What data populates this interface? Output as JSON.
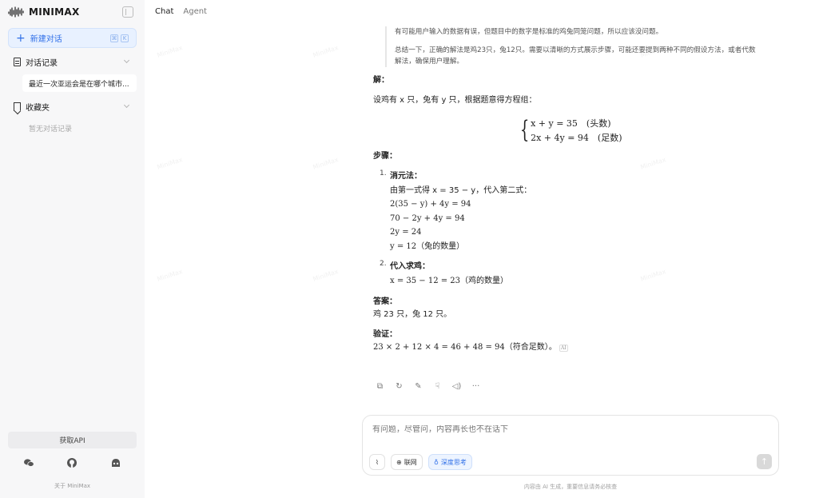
{
  "app": {
    "brand": "MINIMAX"
  },
  "sidebar": {
    "new_chat": "新建对话",
    "history_label": "对话记录",
    "history_items": [
      "最近一次亚运会是在哪个城市..."
    ],
    "favorites_label": "收藏夹",
    "favorites_empty": "暂无对话记录",
    "api_button": "获取API",
    "about": "关于 MiniMax"
  },
  "header": {
    "tabs": [
      "Chat",
      "Agent"
    ]
  },
  "thought": [
    "有可能用户输入的数据有误，但题目中的数字是标准的鸡兔同笼问题，所以应该没问题。",
    "总结一下，正确的解法是鸡23只，兔12只。需要以清晰的方式展示步骤，可能还要提到两种不同的假设方法，或者代数解法，确保用户理解。"
  ],
  "answer": {
    "solution_heading": "解：",
    "setup": "设鸡有 x 只，兔有 y 只，根据题意得方程组：",
    "eq1": "x + y = 35　(头数)",
    "eq2": "2x + 4y = 94　(足数)",
    "steps_heading": "步骤：",
    "step1_title": "消元法：",
    "step1_lines": [
      "由第一式得 x = 35 − y，代入第二式：",
      "2(35 − y) + 4y = 94",
      "70 − 2y + 4y = 94",
      "2y = 24",
      "y = 12（兔的数量）"
    ],
    "step2_title": "代入求鸡：",
    "step2_line": "x = 35 − 12 = 23（鸡的数量）",
    "answer_heading": "答案：",
    "answer_text": "鸡 23 只，兔 12 只。",
    "verify_heading": "验证：",
    "verify_text": "23 × 2 + 12 × 4 = 46 + 48 = 94（符合足数）。",
    "ai_badge": "AI"
  },
  "input": {
    "placeholder": "有问题，尽管问，内容再长也不在话下",
    "web_label": "联网",
    "deep_label": "深度思考"
  },
  "disclaimer": "内容由 AI 生成，重要信息请务必核查",
  "colors": {
    "accent": "#2f6fe8",
    "sidebar_bg": "#f7f7f8"
  }
}
